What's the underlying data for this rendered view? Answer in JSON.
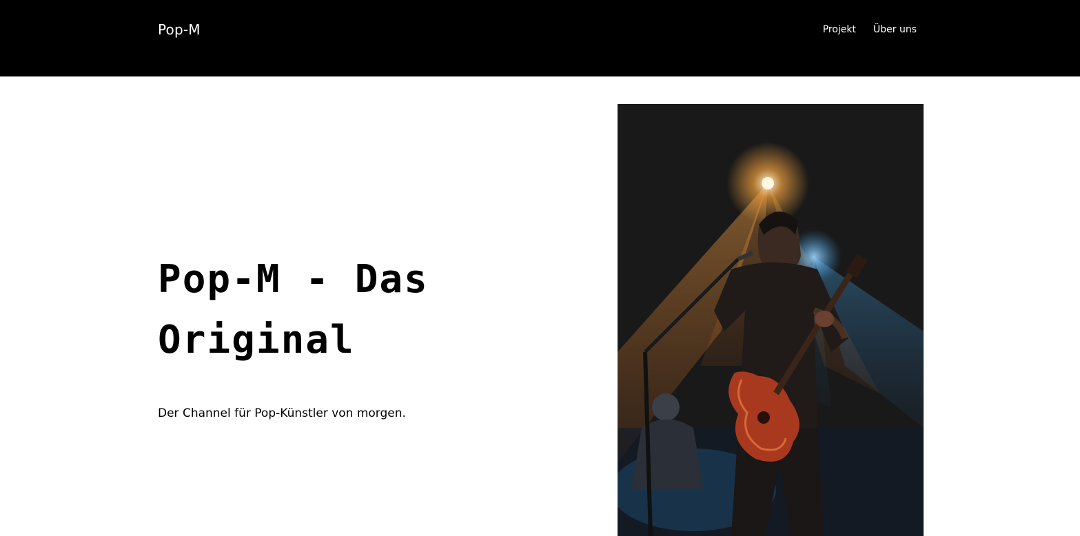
{
  "header": {
    "logo": "Pop-M",
    "nav": [
      {
        "label": "Projekt"
      },
      {
        "label": "Über uns"
      }
    ]
  },
  "hero": {
    "title": "Pop-M - Das Original",
    "subtitle": "Der Channel für Pop-Künstler von morgen."
  },
  "colors": {
    "header_bg": "#000000",
    "page_bg": "#ffffff",
    "spotlight_orange": "#e8862a",
    "spotlight_blue": "#2b8fd6"
  }
}
